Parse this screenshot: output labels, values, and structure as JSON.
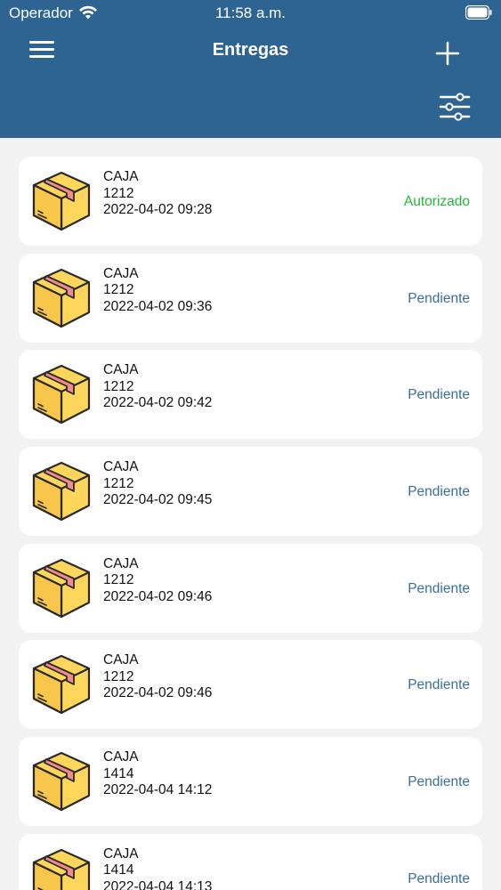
{
  "status_bar": {
    "carrier": "Operador",
    "time": "11:58 a.m."
  },
  "header": {
    "title": "Entregas"
  },
  "colors": {
    "header": "#2e6492",
    "authorized": "#21b53a",
    "pending": "#3a6e98"
  },
  "deliveries": [
    {
      "type": "CAJA",
      "code": "1212",
      "datetime": "2022-04-02 09:28",
      "status": "Autorizado"
    },
    {
      "type": "CAJA",
      "code": "1212",
      "datetime": "2022-04-02 09:36",
      "status": "Pendiente"
    },
    {
      "type": "CAJA",
      "code": "1212",
      "datetime": "2022-04-02 09:42",
      "status": "Pendiente"
    },
    {
      "type": "CAJA",
      "code": "1212",
      "datetime": "2022-04-02 09:45",
      "status": "Pendiente"
    },
    {
      "type": "CAJA",
      "code": "1212",
      "datetime": "2022-04-02 09:46",
      "status": "Pendiente"
    },
    {
      "type": "CAJA",
      "code": "1212",
      "datetime": "2022-04-02 09:46",
      "status": "Pendiente"
    },
    {
      "type": "CAJA",
      "code": "1414",
      "datetime": "2022-04-04 14:12",
      "status": "Pendiente"
    },
    {
      "type": "CAJA",
      "code": "1414",
      "datetime": "2022-04-04 14:13",
      "status": "Pendiente"
    }
  ]
}
